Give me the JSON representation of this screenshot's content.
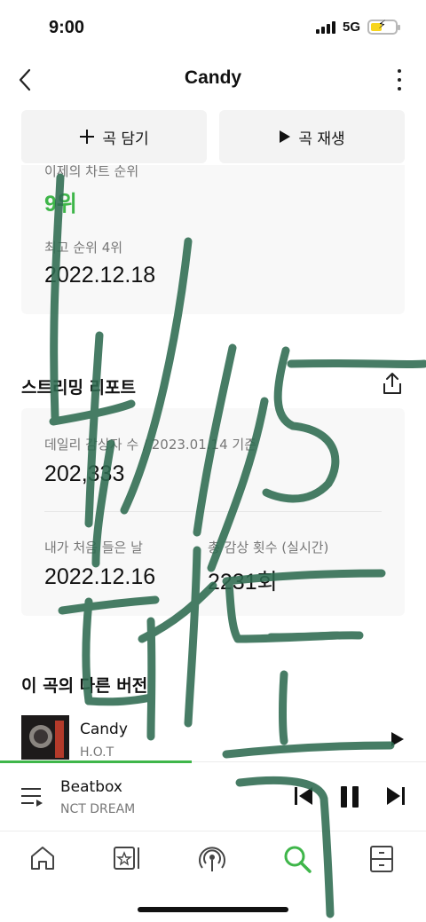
{
  "status": {
    "time": "9:00",
    "network": "5G"
  },
  "header": {
    "title": "Candy"
  },
  "actions": {
    "add_label": "곡 담기",
    "play_label": "곡 재생"
  },
  "chart": {
    "prev_label": "이제의 차트 순위",
    "rank": "9위",
    "best_label": "최고 순위 4위",
    "best_date": "2022.12.18"
  },
  "report": {
    "title": "스트리밍 리포트",
    "daily_label": "데일리 감상자 수 / 2023.01.14 기준",
    "daily_value": "202,333",
    "first_label": "내가 처음 들은 날",
    "first_value": "2022.12.16",
    "total_label": "총 감상 횟수 (실시간)",
    "total_value": "2231회"
  },
  "versions": {
    "title": "이 곡의 다른 버전",
    "items": [
      {
        "title": "Candy",
        "artist": "H.O.T"
      }
    ]
  },
  "player": {
    "title": "Beatbox",
    "artist": "NCT DREAM",
    "progress": 0.45
  },
  "colors": {
    "accent": "#3fb64a",
    "scribble": "#2e6b50"
  },
  "tabs": [
    {
      "name": "home-icon"
    },
    {
      "name": "library-icon"
    },
    {
      "name": "podcast-icon"
    },
    {
      "name": "search-icon",
      "active": true
    },
    {
      "name": "storage-icon"
    }
  ]
}
